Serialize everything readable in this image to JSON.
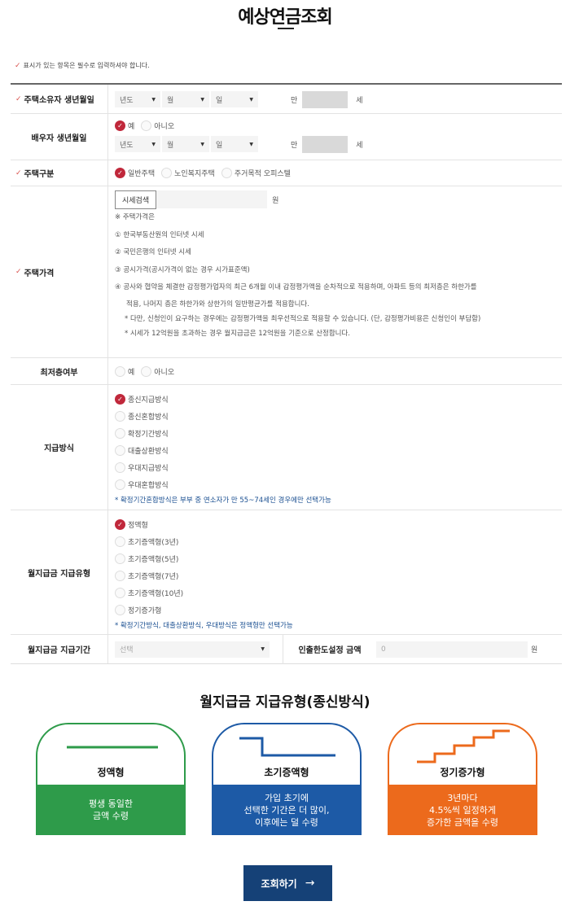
{
  "title": "예상연금조회",
  "required_note": "표시가 있는 항목은 필수로 입력하셔야 합니다.",
  "form": {
    "owner_birth": {
      "label": "주택소유자 생년월일",
      "year": "년도",
      "month": "월",
      "day": "일",
      "man": "만",
      "age_unit": "세"
    },
    "spouse_birth": {
      "label": "배우자 생년월일",
      "yes": "예",
      "no": "아니오",
      "year": "년도",
      "month": "월",
      "day": "일",
      "man": "만",
      "age_unit": "세"
    },
    "house_type": {
      "label": "주택구분",
      "options": [
        "일반주택",
        "노인복지주택",
        "주거목적 오피스텔"
      ],
      "selected": 0
    },
    "house_price": {
      "label": "주택가격",
      "search_button": "시세검색",
      "unit": "원",
      "notes": [
        "※ 주택가격은",
        "① 한국부동산원의 인터넷 시세",
        "② 국민은행의 인터넷 시세",
        "③ 공시가격(공시가격이 없는 경우 시가표준액)",
        "④ 공사와 협약을 체결한 감정평가업자의 최근 6개월 이내 감정평가액을 순차적으로 적용하며, 아파트 등의 최저층은 하한가를",
        "적용, 나머지 층은 하한가와 상한가의 일반평균가를 적용합니다.",
        "* 다만, 신청인이 요구하는 경우에는 감정평가액을 최우선적으로 적용할 수 있습니다. (단, 감정평가비용은 신청인이 부담함)",
        "* 시세가 12억원을 초과하는 경우 월지급금은 12억원을 기준으로 산정합니다."
      ]
    },
    "lowest_floor": {
      "label": "최저층여부",
      "yes": "예",
      "no": "아니오"
    },
    "payment_method": {
      "label": "지급방식",
      "options": [
        "종신지급방식",
        "종신혼합방식",
        "확정기간방식",
        "대출상환방식",
        "우대지급방식",
        "우대혼합방식"
      ],
      "selected": 0,
      "note": "* 확정기간혼합방식은 부부 중 연소자가 만 55~74세인 경우에만 선택가능"
    },
    "monthly_type": {
      "label": "월지급금 지급유형",
      "options": [
        "정액형",
        "초기증액형(3년)",
        "초기증액형(5년)",
        "초기증액형(7년)",
        "초기증액형(10년)",
        "정기증가형"
      ],
      "selected": 0,
      "note": "* 확정기간방식, 대출상환방식, 우대방식은 정액형만 선택가능"
    },
    "monthly_period": {
      "label": "월지급금 지급기간",
      "placeholder": "선택",
      "limit_label": "인출한도설정 금액",
      "limit_value": "0",
      "limit_unit": "원"
    }
  },
  "types_section": {
    "title": "월지급금  지급유형(종신방식)",
    "cards": [
      {
        "name": "정액형",
        "desc": "평생 동일한\n금액 수령",
        "color": "#2e9b4a"
      },
      {
        "name": "초기증액형",
        "desc": "가입 초기에\n선택한 기간은 더 많이,\n이후에는 덜 수령",
        "color": "#1d5aa6"
      },
      {
        "name": "정기증가형",
        "desc": "3년마다\n4.5%씩 일정하게\n증가한 금액을 수령",
        "color": "#ec6a1c"
      }
    ]
  },
  "submit_label": "조회하기",
  "submit_arrow": "→",
  "check_mark": "✓"
}
